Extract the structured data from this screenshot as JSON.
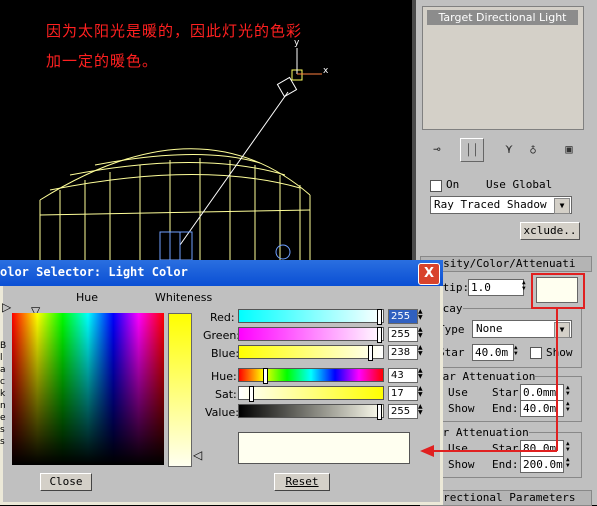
{
  "annotation": {
    "line1": "因为太阳光是暖的，因此灯光的色彩",
    "line2": "加一定的暖色。"
  },
  "viewport": {
    "axis_y": "y",
    "axis_x": "x"
  },
  "right_panel": {
    "object_name": "Target Directional Light",
    "shadows": {
      "on_label": "On",
      "use_global_label": "Use Global",
      "type_value": "Ray Traced Shadow",
      "exclude_label": "xclude.."
    },
    "intensity": {
      "header": "nsity/Color/Attenuati",
      "multiplier_label": "ltip:",
      "multiplier_value": "1.0",
      "light_color": "#fffff0"
    },
    "decay": {
      "group_label": "ecay",
      "type_label": "Type",
      "type_value": "None",
      "start_label": "Star",
      "start_value": "40.0m",
      "show_label": "Show"
    },
    "near_atten": {
      "group_label": "ear Attenuation",
      "use_label": "Use",
      "show_label": "Show",
      "start_label": "Star",
      "start_value": "0.0mm",
      "end_label": "End:",
      "end_value": "40.0m"
    },
    "far_atten": {
      "group_label": "ar Attenuation",
      "use_label": "Use",
      "show_label": "Show",
      "start_label": "Star",
      "start_value": "80.0m",
      "end_label": "End:",
      "end_value": "200.0m"
    },
    "directional_header": "irectional Parameters"
  },
  "dialog": {
    "title": "olor Selector: Light Color",
    "hue_label": "Hue",
    "whiteness_label": "Whiteness",
    "red_label": "Red:",
    "red_value": "255",
    "green_label": "Green:",
    "green_value": "255",
    "blue_label": "Blue:",
    "blue_value": "238",
    "hue2_label": "Hue:",
    "hue_value": "43",
    "sat_label": "Sat:",
    "sat_value": "17",
    "value_label": "Value:",
    "value_value": "255",
    "color_preview": "#fffff0",
    "close_label": "Close",
    "reset_label": "Reset",
    "blackness_letters": "Blackness",
    "close_x": "X"
  },
  "colors": {
    "annotation": "#ff2020",
    "wireframe": "#ffff80",
    "highlight_box": "#e02020"
  }
}
